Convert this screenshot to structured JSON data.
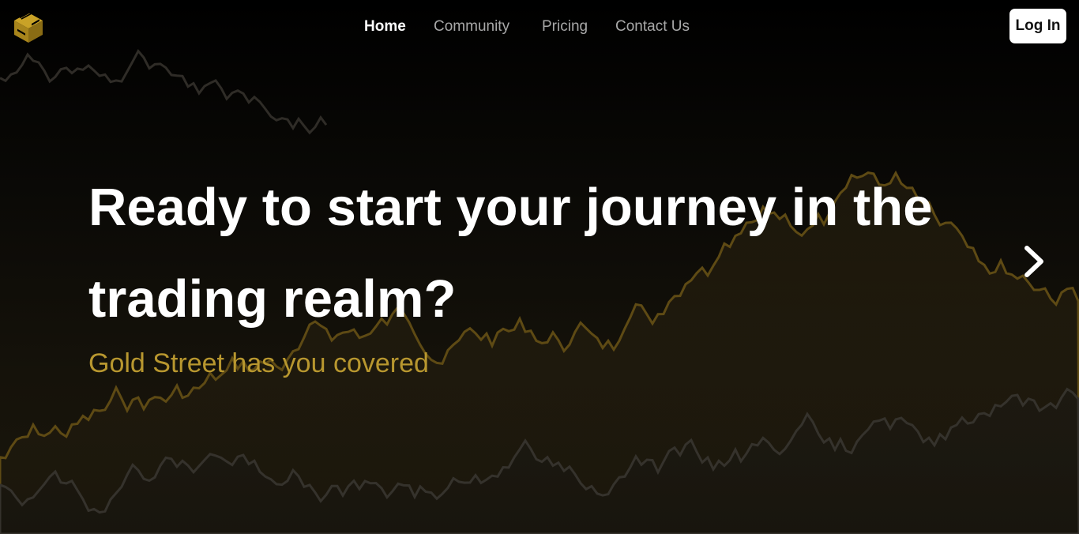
{
  "brand": {
    "logo_name": "gold-street-logo",
    "accent_color": "#c9a227"
  },
  "nav": {
    "items": [
      {
        "label": "Home",
        "active": true
      },
      {
        "label": "Community",
        "active": false
      },
      {
        "label": "Pricing",
        "active": false
      },
      {
        "label": "Contact Us",
        "active": false
      }
    ],
    "login_label": "Log In"
  },
  "hero": {
    "headline": "Ready to start your journey in the trading realm?",
    "subheadline": "Gold Street has you covered",
    "next_icon": "chevron-right-icon"
  },
  "colors": {
    "background": "#000000",
    "headline": "#ffffff",
    "subheadline": "#b8972f",
    "chart_line_gold": "#6b5416",
    "chart_line_gray": "#3a3630"
  }
}
